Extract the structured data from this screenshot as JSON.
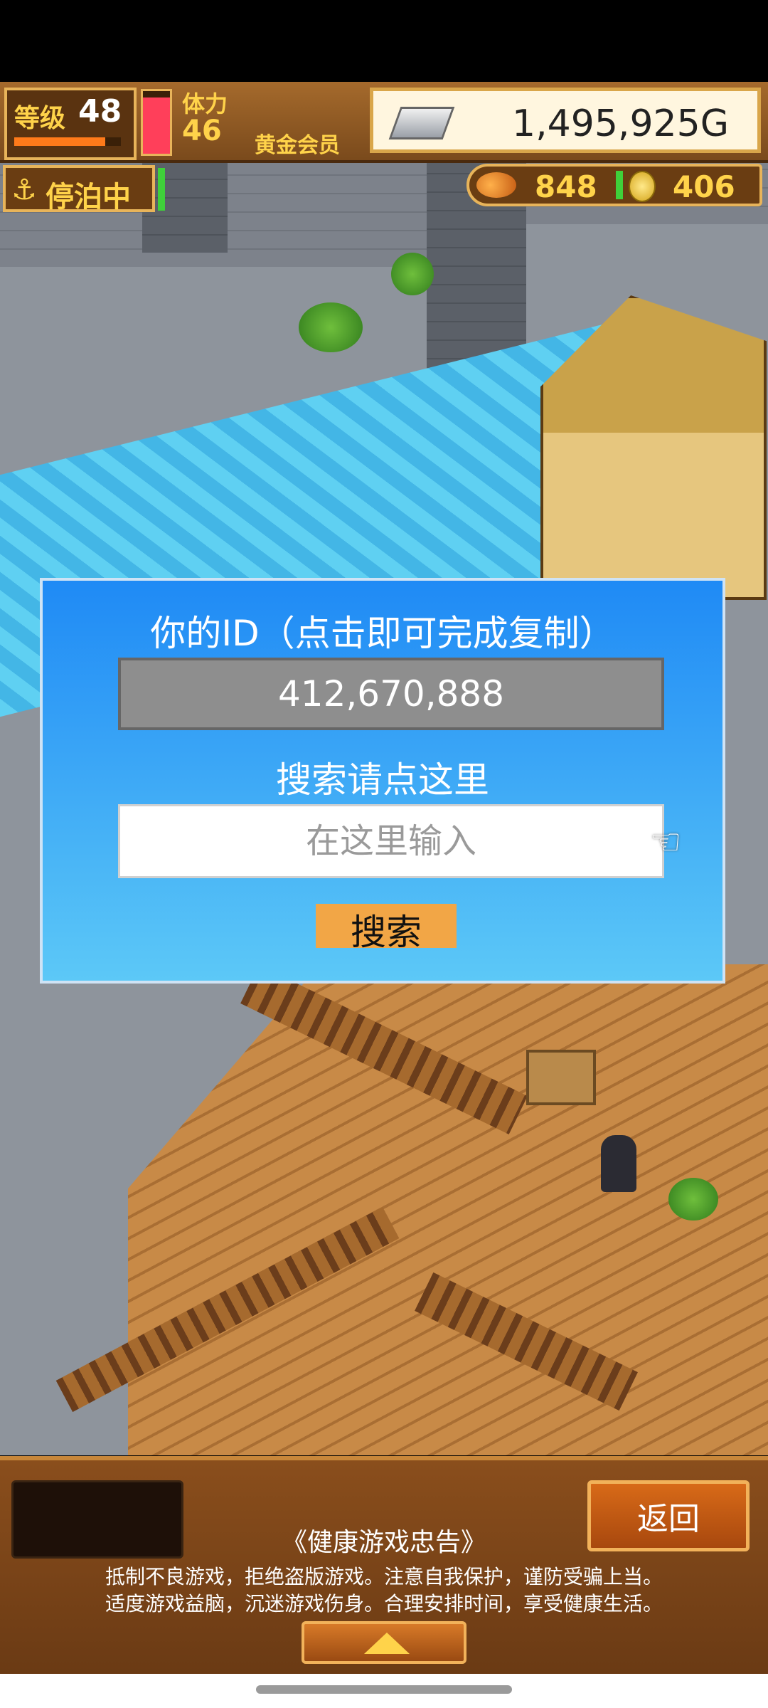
{
  "hud": {
    "level_label": "等级",
    "level_value": "48",
    "exp_fraction": 0.85,
    "stamina_label": "体力",
    "stamina_value": "46",
    "stamina_fraction": 0.9,
    "member_label": "黄金会员",
    "gold_value": "1,495,925G"
  },
  "status": {
    "docked_text": "停泊中"
  },
  "resources": {
    "fish_value": "848",
    "medal_value": "406"
  },
  "dialog": {
    "title": "你的ID（点击即可完成复制）",
    "user_id": "412,670,888",
    "search_label": "搜索请点这里",
    "search_placeholder": "在这里输入",
    "search_button": "搜索"
  },
  "bottom": {
    "back_button": "返回",
    "advice_title": "《健康游戏忠告》",
    "advice_line1": "抵制不良游戏，拒绝盗版游戏。注意自我保护，谨防受骗上当。",
    "advice_line2": "适度游戏益脑，沉迷游戏伤身。合理安排时间，享受健康生活。"
  },
  "colors": {
    "dialog_top": "#1f8af5",
    "dialog_bottom": "#5cc8f7",
    "search_button": "#f2a646",
    "hud_gold_text": "#ffd34a"
  }
}
